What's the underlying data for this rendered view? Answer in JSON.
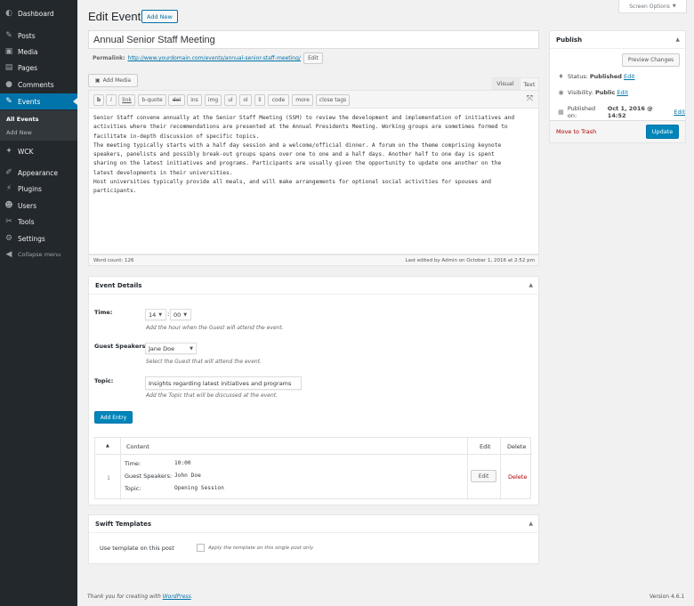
{
  "sidebar": {
    "items": [
      {
        "label": "Dashboard",
        "icon": "dashboard-icon"
      },
      {
        "label": "Posts",
        "icon": "pushpin-icon"
      },
      {
        "label": "Media",
        "icon": "media-icon"
      },
      {
        "label": "Pages",
        "icon": "pages-icon"
      },
      {
        "label": "Comments",
        "icon": "comment-icon"
      },
      {
        "label": "Events",
        "icon": "pushpin-icon"
      },
      {
        "label": "WCK",
        "icon": "wrench-icon"
      },
      {
        "label": "Appearance",
        "icon": "brush-icon"
      },
      {
        "label": "Plugins",
        "icon": "plugin-icon"
      },
      {
        "label": "Users",
        "icon": "users-icon"
      },
      {
        "label": "Tools",
        "icon": "tools-icon"
      },
      {
        "label": "Settings",
        "icon": "settings-icon"
      },
      {
        "label": "Collapse menu",
        "icon": "collapse-icon"
      }
    ],
    "submenu": [
      "All Events",
      "Add New"
    ]
  },
  "header": {
    "title": "Edit Event",
    "add_new": "Add New",
    "screen_options": "Screen Options"
  },
  "post": {
    "title": "Annual Senior Staff Meeting",
    "permalink_label": "Permalink:",
    "permalink_url": "http://www.yourdomain.com/events/annual-senior-staff-meeting/",
    "permalink_edit": "Edit"
  },
  "editor": {
    "add_media": "Add Media",
    "tab_visual": "Visual",
    "tab_text": "Text",
    "toolbar": [
      "b",
      "i",
      "link",
      "b-quote",
      "del",
      "ins",
      "img",
      "ul",
      "ol",
      "li",
      "code",
      "more",
      "close tags"
    ],
    "content_lines": [
      "Senior Staff convene annually at the Senior Staff Meeting (SSM) to review the development and implementation of initiatives and",
      "activities where their recommendations are presented at the Annual Presidents Meeting. Working groups are sometimes formed to",
      "facilitate in-depth discussion of specific topics.",
      "The meeting typically starts with a half day session and a welcome/official dinner. A forum on the theme comprising keynote",
      "speakers, panelists and possibly break-out groups spans over one to one and a half days. Another half to one day is spent",
      "sharing on the latest initiatives and programs.  Participants are usually given the opportunity to update one another on the",
      "latest developments in their universities.",
      "Host universities typically provide all meals, and will make arrangements for optional social activities for spouses and",
      "participants."
    ],
    "word_count": "Word count: 126",
    "last_edited": "Last edited by Admin on October 1, 2016 at 2:52 pm"
  },
  "event_details": {
    "title": "Event Details",
    "time_label": "Time:",
    "time_hour": "14",
    "time_minute": "00",
    "time_desc": "Add the hour when the Guest will attend the event.",
    "guest_label": "Guest Speakers:",
    "guest_value": "Jane Doe",
    "guest_desc": "Select the Guest that will attend the event.",
    "topic_label": "Topic:",
    "topic_value": "Insights regarding latest initiatives and programs",
    "topic_desc": "Add the Topic that will be discussed at the event.",
    "add_entry": "Add Entry",
    "table": {
      "sort_glyph": "▲",
      "col_content": "Content",
      "col_edit": "Edit",
      "col_delete": "Delete",
      "row_index": "1",
      "row_time_label": "Time:",
      "row_time_value": "10:00",
      "row_guest_label": "Guest Speakers:",
      "row_guest_value": "John Doe",
      "row_topic_label": "Topic:",
      "row_topic_value": "Opening Session",
      "row_edit": "Edit",
      "row_delete": "Delete"
    }
  },
  "swift_templates": {
    "title": "Swift Templates",
    "label": "Use template on this post",
    "checkbox_label": "Apply the template on this single post only"
  },
  "publish": {
    "title": "Publish",
    "preview": "Preview Changes",
    "status_label": "Status:",
    "status_value": "Published",
    "visibility_label": "Visibility:",
    "visibility_value": "Public",
    "published_label": "Published on:",
    "published_value": "Oct 1, 2016 @ 14:52",
    "edit_link": "Edit",
    "trash": "Move to Trash",
    "update": "Update"
  },
  "footer": {
    "thanks": "Thank you for creating with ",
    "wp_link": "WordPress",
    "version": "Version 4.6.1"
  },
  "colors": {
    "sidebar_bg": "#23282d",
    "active": "#0073aa",
    "primary_button": "#0085ba",
    "delete": "#a00"
  }
}
